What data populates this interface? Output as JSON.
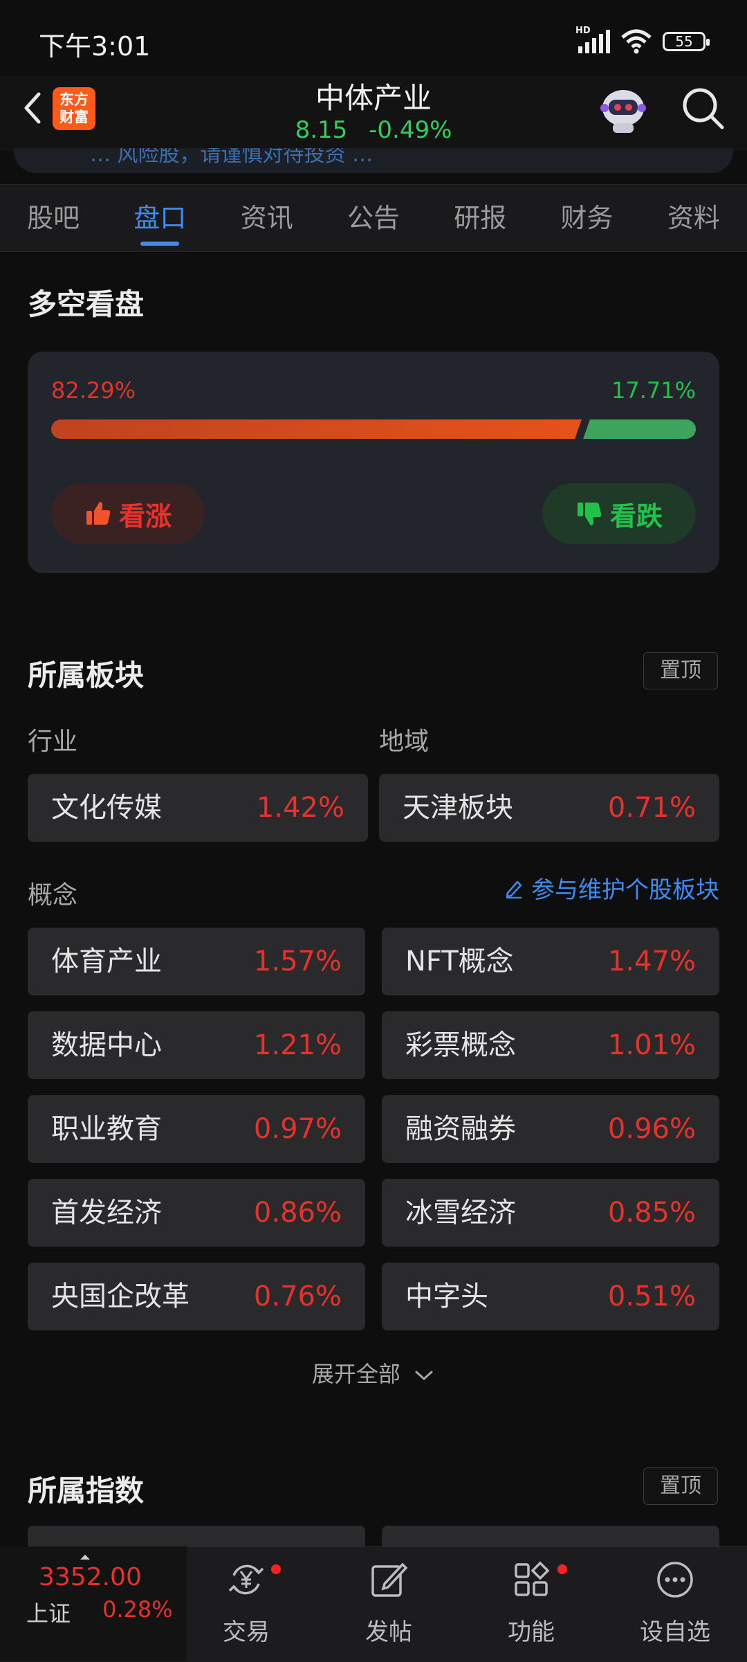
{
  "status_bar": {
    "time": "下午3:01",
    "network_badge": "HD",
    "battery": "55"
  },
  "header": {
    "title": "中体产业",
    "price": "8.15",
    "change_pct": "-0.49%",
    "logo_line1": "东方",
    "logo_line2": "财富",
    "banner_text": "… 风险股，请谨慎对待投资 …"
  },
  "tabs": [
    {
      "label": "股吧",
      "active": false
    },
    {
      "label": "盘口",
      "active": true
    },
    {
      "label": "资讯",
      "active": false
    },
    {
      "label": "公告",
      "active": false
    },
    {
      "label": "研报",
      "active": false
    },
    {
      "label": "财务",
      "active": false
    },
    {
      "label": "资料",
      "active": false
    }
  ],
  "sentiment": {
    "title": "多空看盘",
    "bull_pct": "82.29%",
    "bear_pct": "17.71%",
    "bull_fraction": 0.8229,
    "bull_label": "看涨",
    "bear_label": "看跌"
  },
  "sectors": {
    "title": "所属板块",
    "pin_label": "置顶",
    "industry_label": "行业",
    "region_label": "地域",
    "industry": {
      "name": "文化传媒",
      "pct": "1.42%"
    },
    "region": {
      "name": "天津板块",
      "pct": "0.71%"
    },
    "concept_label": "概念",
    "maintain_link": "参与维护个股板块",
    "concepts": [
      {
        "name": "体育产业",
        "pct": "1.57%"
      },
      {
        "name": "NFT概念",
        "pct": "1.47%"
      },
      {
        "name": "数据中心",
        "pct": "1.21%"
      },
      {
        "name": "彩票概念",
        "pct": "1.01%"
      },
      {
        "name": "职业教育",
        "pct": "0.97%"
      },
      {
        "name": "融资融券",
        "pct": "0.96%"
      },
      {
        "name": "首发经济",
        "pct": "0.86%"
      },
      {
        "name": "冰雪经济",
        "pct": "0.85%"
      },
      {
        "name": "央国企改革",
        "pct": "0.76%"
      },
      {
        "name": "中字头",
        "pct": "0.51%"
      }
    ],
    "expand_label": "展开全部"
  },
  "indices": {
    "title": "所属指数",
    "pin_label": "置顶"
  },
  "bottom_nav": {
    "index_value": "3352.00",
    "index_name": "上证",
    "index_change": "0.28%",
    "items": [
      {
        "label": "交易",
        "icon": "trade-yen-icon",
        "badge": true
      },
      {
        "label": "发帖",
        "icon": "compose-icon",
        "badge": false
      },
      {
        "label": "功能",
        "icon": "grid-apps-icon",
        "badge": true
      },
      {
        "label": "设自选",
        "icon": "more-dots-icon",
        "badge": false
      }
    ]
  },
  "colors": {
    "rise": "#e8312a",
    "fall": "#22c14a",
    "accent": "#3f8cf0",
    "background": "#0e0e0f"
  }
}
